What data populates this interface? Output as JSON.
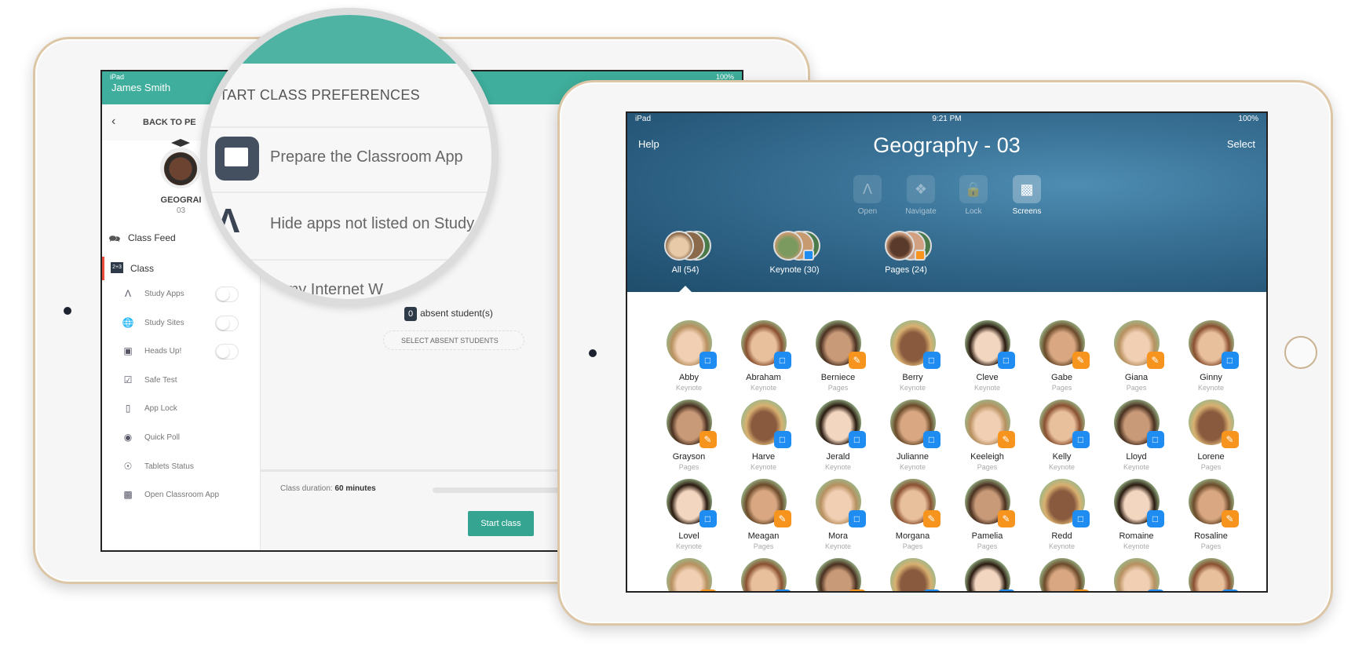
{
  "left_app": {
    "status": {
      "device": "iPad",
      "battery": "100%"
    },
    "user_name": "James Smith",
    "back_label": "BACK TO PE",
    "class_name": "GEOGRAI",
    "class_number": "03",
    "menu": [
      {
        "label": "Class Feed",
        "icon": "chat-icon"
      },
      {
        "label": "Class",
        "icon": "class-board-icon",
        "active": true
      }
    ],
    "submenu": [
      {
        "label": "Study Apps",
        "icon": "app-store-icon",
        "toggle": true
      },
      {
        "label": "Study Sites",
        "icon": "globe-icon",
        "toggle": true
      },
      {
        "label": "Heads Up!",
        "icon": "heads-up-icon",
        "toggle": true
      },
      {
        "label": "Safe Test",
        "icon": "checklist-icon"
      },
      {
        "label": "App Lock",
        "icon": "tablet-lock-icon"
      },
      {
        "label": "Quick Poll",
        "icon": "poll-icon"
      },
      {
        "label": "Tablets Status",
        "icon": "eye-icon"
      },
      {
        "label": "Open Classroom App",
        "icon": "classroom-app-icon"
      }
    ],
    "absent_count": "0",
    "absent_label": "absent student(s)",
    "select_absent_label": "SELECT ABSENT STUDENTS",
    "duration_label": "Class duration:",
    "duration_value": "60 minutes",
    "start_label": "Start class"
  },
  "magnifier": {
    "heading": "START CLASS PREFERENCES",
    "rows": [
      "Prepare the Classroom App",
      "Hide apps not listed on Study",
      "Apply my Internet W"
    ]
  },
  "right_app": {
    "status": {
      "device": "iPad",
      "time": "9:21 PM",
      "battery": "100%"
    },
    "help_label": "Help",
    "select_label": "Select",
    "title": "Geography - 03",
    "actions": [
      {
        "label": "Open",
        "icon": "app-store-icon"
      },
      {
        "label": "Navigate",
        "icon": "compass-icon"
      },
      {
        "label": "Lock",
        "icon": "lock-icon"
      },
      {
        "label": "Screens",
        "icon": "screen-icon",
        "active": true
      }
    ],
    "groups": [
      {
        "label": "All (54)",
        "selected": true
      },
      {
        "label": "Keynote (30)",
        "app": "Keynote"
      },
      {
        "label": "Pages (24)",
        "app": "Pages"
      }
    ],
    "app_colors": {
      "Keynote": "#1e8cf0",
      "Pages": "#f7941d"
    },
    "students": [
      {
        "name": "Abby",
        "app": "Keynote"
      },
      {
        "name": "Abraham",
        "app": "Keynote"
      },
      {
        "name": "Berniece",
        "app": "Pages"
      },
      {
        "name": "Berry",
        "app": "Keynote"
      },
      {
        "name": "Cleve",
        "app": "Keynote"
      },
      {
        "name": "Gabe",
        "app": "Pages"
      },
      {
        "name": "Giana",
        "app": "Pages"
      },
      {
        "name": "Ginny",
        "app": "Keynote"
      },
      {
        "name": "Grayson",
        "app": "Pages"
      },
      {
        "name": "Harve",
        "app": "Keynote"
      },
      {
        "name": "Jerald",
        "app": "Keynote"
      },
      {
        "name": "Julianne",
        "app": "Keynote"
      },
      {
        "name": "Keeleigh",
        "app": "Pages"
      },
      {
        "name": "Kelly",
        "app": "Keynote"
      },
      {
        "name": "Lloyd",
        "app": "Keynote"
      },
      {
        "name": "Lorene",
        "app": "Pages"
      },
      {
        "name": "Lovel",
        "app": "Keynote"
      },
      {
        "name": "Meagan",
        "app": "Pages"
      },
      {
        "name": "Mora",
        "app": "Keynote"
      },
      {
        "name": "Morgana",
        "app": "Pages"
      },
      {
        "name": "Pamelia",
        "app": "Pages"
      },
      {
        "name": "Redd",
        "app": "Keynote"
      },
      {
        "name": "Romaine",
        "app": "Keynote"
      },
      {
        "name": "Rosaline",
        "app": "Pages"
      }
    ],
    "partial_row_apps": [
      "Pages",
      "Keynote",
      "Pages",
      "Keynote",
      "Keynote",
      "Pages",
      "Keynote",
      "Keynote"
    ]
  }
}
